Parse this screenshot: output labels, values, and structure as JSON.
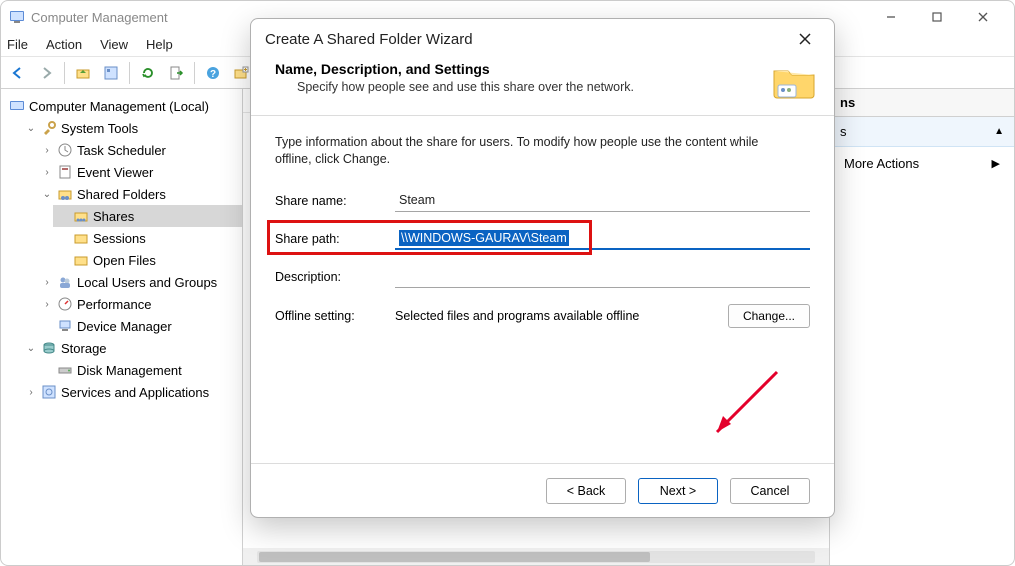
{
  "window": {
    "title": "Computer Management"
  },
  "menu": {
    "file": "File",
    "action": "Action",
    "view": "View",
    "help": "Help"
  },
  "tree": {
    "root": "Computer Management (Local)",
    "system_tools": "System Tools",
    "task_scheduler": "Task Scheduler",
    "event_viewer": "Event Viewer",
    "shared_folders": "Shared Folders",
    "shares": "Shares",
    "sessions": "Sessions",
    "open_files": "Open Files",
    "local_users": "Local Users and Groups",
    "performance": "Performance",
    "device_manager": "Device Manager",
    "storage": "Storage",
    "disk_management": "Disk Management",
    "services_apps": "Services and Applications"
  },
  "right": {
    "header": "ns",
    "sub": "s",
    "more": "More Actions"
  },
  "dialog": {
    "title": "Create A Shared Folder Wizard",
    "heading": "Name, Description, and Settings",
    "subheading": "Specify how people see and use this share over the network.",
    "intro": "Type information about the share for users. To modify how people use the content while offline, click Change.",
    "share_name_label": "Share name:",
    "share_name": "Steam",
    "share_path_label": "Share path:",
    "share_path": "\\\\WINDOWS-GAURAV\\Steam",
    "description_label": "Description:",
    "description": "",
    "offline_label": "Offline setting:",
    "offline_value": "Selected files and programs available offline",
    "change": "Change...",
    "back": "< Back",
    "next": "Next >",
    "cancel": "Cancel"
  }
}
